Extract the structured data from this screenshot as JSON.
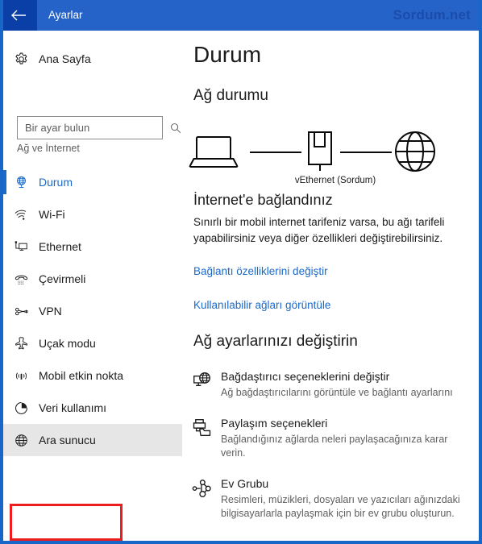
{
  "titlebar": {
    "back_icon": "back-arrow-icon",
    "title": "Ayarlar",
    "watermark": "Sordum.net"
  },
  "sidebar": {
    "home": {
      "label": "Ana Sayfa",
      "icon": "gear-icon"
    },
    "search": {
      "placeholder": "Bir ayar bulun",
      "value": "",
      "icon": "search-icon"
    },
    "section_header": "Ağ ve İnternet",
    "items": [
      {
        "label": "Durum",
        "icon": "network-globe-icon",
        "selected": true,
        "hover": false
      },
      {
        "label": "Wi-Fi",
        "icon": "wifi-icon",
        "selected": false,
        "hover": false
      },
      {
        "label": "Ethernet",
        "icon": "ethernet-icon",
        "selected": false,
        "hover": false
      },
      {
        "label": "Çevirmeli",
        "icon": "dialup-phone-icon",
        "selected": false,
        "hover": false
      },
      {
        "label": "VPN",
        "icon": "vpn-key-icon",
        "selected": false,
        "hover": false
      },
      {
        "label": "Uçak modu",
        "icon": "airplane-icon",
        "selected": false,
        "hover": false
      },
      {
        "label": "Mobil etkin nokta",
        "icon": "hotspot-icon",
        "selected": false,
        "hover": false
      },
      {
        "label": "Veri kullanımı",
        "icon": "pie-chart-icon",
        "selected": false,
        "hover": false
      },
      {
        "label": "Ara sunucu",
        "icon": "globe-icon",
        "selected": false,
        "hover": true
      }
    ],
    "highlight_color": "#ee1c1c"
  },
  "content": {
    "page_title": "Durum",
    "network_status_heading": "Ağ durumu",
    "diagram": {
      "device_icon": "laptop-icon",
      "adapter_icon": "network-adapter-icon",
      "internet_icon": "globe-icon",
      "adapter_label": "vEthernet (Sordum)"
    },
    "status_title": "İnternet'e bağlandınız",
    "status_desc": "Sınırlı bir mobil internet tarifeniz varsa, bu ağı tarifeli yapabilirsiniz veya diğer özellikleri değiştirebilirsiniz.",
    "links": [
      "Bağlantı özelliklerini değiştir",
      "Kullanılabilir ağları görüntüle"
    ],
    "change_settings_heading": "Ağ ayarlarınızı değiştirin",
    "options": [
      {
        "icon": "adapter-options-icon",
        "title": "Bağdaştırıcı seçeneklerini değiştir",
        "desc": "Ağ bağdaştırıcılarını görüntüle ve bağlantı ayarlarını"
      },
      {
        "icon": "sharing-options-icon",
        "title": "Paylaşım seçenekleri",
        "desc": "Bağlandığınız ağlarda neleri paylaşacağınıza karar verin."
      },
      {
        "icon": "homegroup-icon",
        "title": "Ev Grubu",
        "desc": "Resimleri, müzikleri, dosyaları ve yazıcıları ağınızdaki bilgisayarlarla paylaşmak için bir ev grubu oluşturun."
      }
    ]
  },
  "colors": {
    "titlebar": "#2663c8",
    "back_button": "#0b3fa8",
    "accent": "#1b6ac9",
    "window_border": "#1866c8"
  }
}
